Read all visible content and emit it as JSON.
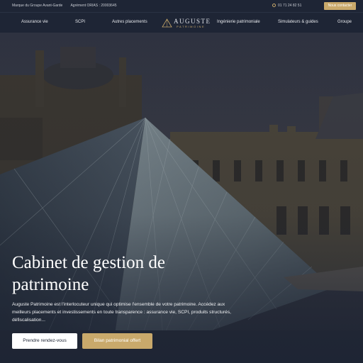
{
  "topbar": {
    "brand_group": "Marque du Groupe Avant-Garde",
    "orias": "Agrément ORIAS : 20003645",
    "phone": "01 71 24 82 51",
    "contact_label": "Nous contacter"
  },
  "nav": {
    "items": [
      {
        "label": "Assurance vie"
      },
      {
        "label": "SCPI"
      },
      {
        "label": "Autres placements"
      },
      {
        "label": "Ingénierie patrimoniale"
      },
      {
        "label": "Simulateurs & guides"
      },
      {
        "label": "Groupe"
      }
    ],
    "logo_name": "AUGUSTE",
    "logo_sub": "PATRIMOINE"
  },
  "hero": {
    "title": "Cabinet de gestion de patrimoine",
    "text": "Auguste Patrimoine est l'interlocuteur unique qui optimise l'ensemble de votre patrimoine. Accédez aux meilleurs placements et investissements en toute transparence : assurance vie, SCPI, produits structurés, défiscalisation...",
    "cta_primary": "Prendre rendez-vous",
    "cta_secondary": "Bilan patrimonial offert"
  },
  "colors": {
    "navy": "#1e2535",
    "gold": "#c9a96b"
  },
  "icons": {
    "phone": "phone-icon",
    "logo": "logo-triangle-icon"
  }
}
